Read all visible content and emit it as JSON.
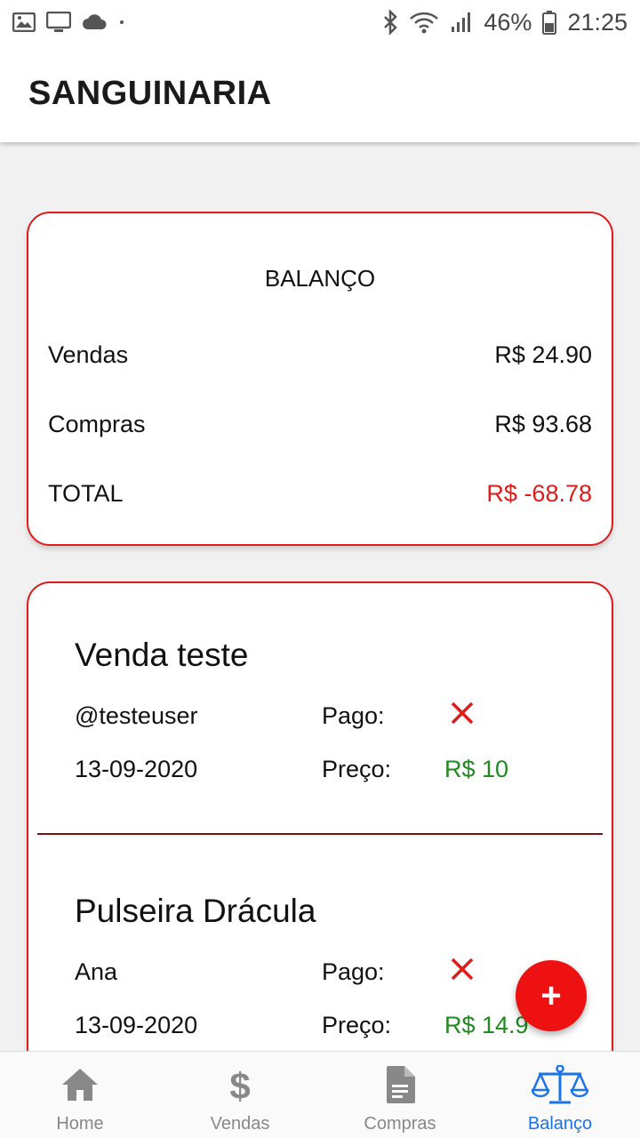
{
  "status_bar": {
    "battery": "46%",
    "time": "21:25"
  },
  "app_bar": {
    "title": "SANGUINARIA"
  },
  "balance": {
    "title": "BALANÇO",
    "rows": [
      {
        "label": "Vendas",
        "value": "R$ 24.90"
      },
      {
        "label": "Compras",
        "value": "R$ 93.68"
      },
      {
        "label": "TOTAL",
        "value": "R$ -68.78"
      }
    ]
  },
  "items": [
    {
      "title": "Venda teste",
      "user": "@testeuser",
      "paid_label": "Pago:",
      "date": "13-09-2020",
      "price_label": "Preço:",
      "price": "R$ 10"
    },
    {
      "title": "Pulseira Drácula",
      "user": "Ana",
      "paid_label": "Pago:",
      "date": "13-09-2020",
      "price_label": "Preço:",
      "price": "R$ 14.9"
    }
  ],
  "fab": {
    "label": "+"
  },
  "bottom_nav": [
    {
      "label": "Home",
      "icon": "home-icon"
    },
    {
      "label": "Vendas",
      "icon": "dollar-icon"
    },
    {
      "label": "Compras",
      "icon": "document-icon"
    },
    {
      "label": "Balanço",
      "icon": "scale-icon"
    }
  ],
  "colors": {
    "accent": "#e01b1b",
    "positive": "#1f8a1f",
    "nav_active": "#1a73e8"
  }
}
